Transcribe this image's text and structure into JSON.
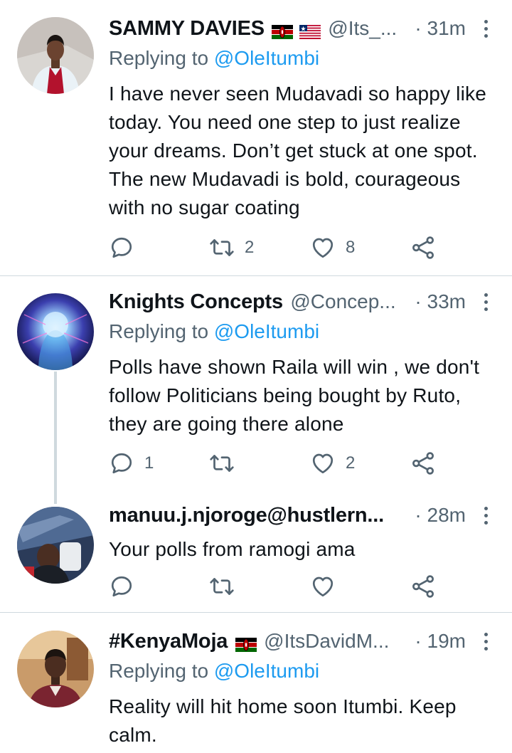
{
  "tweets": [
    {
      "name": "SAMMY DAVIES",
      "handle": "@Its_...",
      "time": "· 31m",
      "replying_label": "Replying to",
      "replying_handle": "@OleItumbi",
      "text": "I have never seen Mudavadi so happy like today. You need one step to just realize your dreams. Don’t get stuck at one spot. The new Mudavadi is bold, courageous with no sugar coating",
      "reply_count": "",
      "retweet_count": "2",
      "like_count": "8"
    },
    {
      "name": "Knights Concepts",
      "handle": "@Concep...",
      "time": "· 33m",
      "replying_label": "Replying to",
      "replying_handle": "@OleItumbi",
      "text": "Polls have shown Raila will win , we don't follow Politicians being bought by Ruto, they are going there alone",
      "reply_count": "1",
      "retweet_count": "",
      "like_count": "2"
    },
    {
      "name": "manuu.j.njoroge@hustlern...",
      "handle": "",
      "time": "· 28m",
      "text": "Your polls from ramogi ama",
      "reply_count": "",
      "retweet_count": "",
      "like_count": ""
    },
    {
      "name": "#KenyaMoja",
      "handle": "@ItsDavidM...",
      "time": "· 19m",
      "replying_label": "Replying to",
      "replying_handle": "@OleItumbi",
      "text": "Reality will hit home soon Itumbi. Keep calm."
    }
  ],
  "colors": {
    "accent": "#1d9bf0",
    "secondary": "#536471",
    "divider": "#cfd9de"
  },
  "icons": [
    "reply-icon",
    "retweet-icon",
    "like-icon",
    "share-icon",
    "more-icon",
    "kenya-flag-icon",
    "liberia-flag-icon"
  ]
}
